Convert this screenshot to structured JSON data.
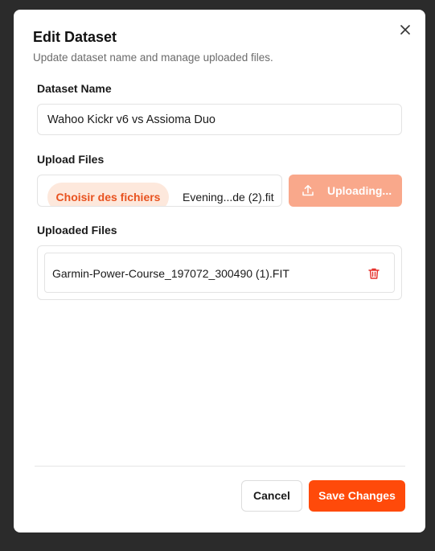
{
  "dialog": {
    "title": "Edit Dataset",
    "subtitle": "Update dataset name and manage uploaded files.",
    "close_icon": "close-icon"
  },
  "dataset_name": {
    "label": "Dataset Name",
    "value": "Wahoo Kickr v6 vs Assioma Duo"
  },
  "upload": {
    "label": "Upload Files",
    "choose_label": "Choisir des fichiers",
    "selected_file": "Evening...de (2).fit",
    "button_label": "Uploading...",
    "button_icon": "upload-icon",
    "button_state": "disabled"
  },
  "uploaded_files": {
    "label": "Uploaded Files",
    "items": [
      {
        "name": "Garmin-Power-Course_197072_300490 (1).FIT",
        "action_icon": "trash-icon"
      }
    ]
  },
  "footer": {
    "cancel_label": "Cancel",
    "save_label": "Save Changes"
  },
  "colors": {
    "accent": "#ff4a0a",
    "accent_disabled": "#f9a88b",
    "accent_text": "#e8521f",
    "accent_soft_bg": "#fde8dc",
    "trash": "#e5322d",
    "backdrop": "#2b2b2b"
  }
}
